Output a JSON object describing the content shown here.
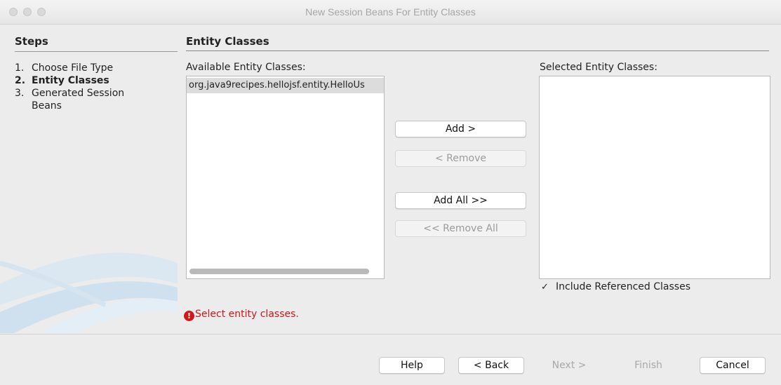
{
  "window": {
    "title": "New Session Beans For Entity Classes"
  },
  "steps": {
    "heading": "Steps",
    "items": [
      {
        "num": "1.",
        "label": "Choose File Type"
      },
      {
        "num": "2.",
        "label": "Entity Classes"
      },
      {
        "num": "3.",
        "label": "Generated Session"
      },
      {
        "num": "",
        "label": "Beans"
      }
    ]
  },
  "main": {
    "heading": "Entity Classes",
    "available_label": "Available Entity Classes:",
    "available_items": [
      "org.java9recipes.hellojsf.entity.HelloUs"
    ],
    "selected_label": "Selected Entity Classes:",
    "include_referenced": {
      "label": "Include Referenced Classes",
      "checked": true,
      "mark": "✓"
    },
    "error": {
      "icon": "!",
      "text": "Select entity classes."
    }
  },
  "buttons": {
    "add": "Add >",
    "remove": "< Remove",
    "add_all": "Add All >>",
    "remove_all": "<< Remove All"
  },
  "footer": {
    "help": "Help",
    "back": "< Back",
    "next": "Next >",
    "finish": "Finish",
    "cancel": "Cancel"
  }
}
